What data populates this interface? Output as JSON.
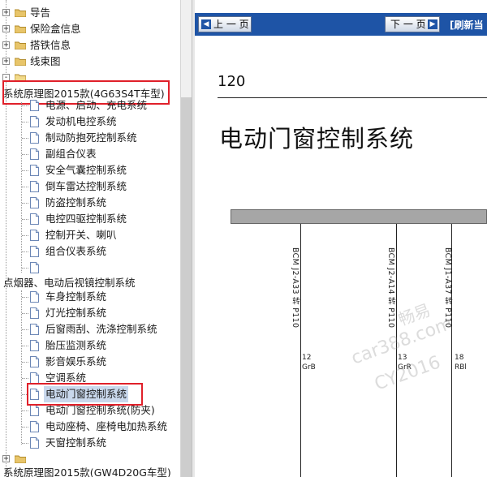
{
  "tree": {
    "top_items": [
      {
        "label": "导告"
      },
      {
        "label": "保险盒信息"
      },
      {
        "label": "搭铁信息"
      },
      {
        "label": "线束图"
      }
    ],
    "section1_title": "系统原理图2015款(4G63S4T车型)",
    "section1_items": [
      {
        "label": "电源、启动、充电系统"
      },
      {
        "label": "发动机电控系统"
      },
      {
        "label": "制动防抱死控制系统"
      },
      {
        "label": "副组合仪表"
      },
      {
        "label": "安全气囊控制系统"
      },
      {
        "label": "倒车雷达控制系统"
      },
      {
        "label": "防盗控制系统"
      },
      {
        "label": "电控四驱控制系统"
      },
      {
        "label": "控制开关、喇叭"
      },
      {
        "label": "组合仪表系统"
      },
      {
        "label": ""
      }
    ],
    "mid_text": "点烟器、电动后视镜控制系统",
    "section2_items": [
      {
        "label": "车身控制系统"
      },
      {
        "label": "灯光控制系统"
      },
      {
        "label": "后窗雨刮、洗涤控制系统"
      },
      {
        "label": "胎压监测系统"
      },
      {
        "label": "影音娱乐系统"
      },
      {
        "label": "空调系统"
      },
      {
        "label": "电动门窗控制系统",
        "selected": true
      },
      {
        "label": "电动门窗控制系统(防夹)"
      },
      {
        "label": "电动座椅、座椅电加热系统"
      },
      {
        "label": "天窗控制系统"
      }
    ],
    "section3_title": "系统原理图2015款(GW4D20G车型)"
  },
  "document": {
    "prev_button": "上 一 页",
    "next_button": "下 一 页",
    "refresh_link": "[刷新当",
    "page_number": "120",
    "title": "电动门窗控制系统",
    "columns": [
      {
        "signal": "BCM J2-A33 转 P110",
        "pin": "12",
        "wire": "GrB"
      },
      {
        "signal": "BCM J2-A14 转 P110",
        "pin": "13",
        "wire": "GrR"
      },
      {
        "signal": "BCM J1-A37 转 P110",
        "pin": "18",
        "wire": "RBl"
      }
    ],
    "watermark": [
      "畅易",
      "car388.com",
      "CY2016"
    ]
  },
  "colors": {
    "nav_bar": "#1e54a6",
    "highlight_box": "#e0202a",
    "selection": "#c9d8ec",
    "table_header": "#a6a6a6"
  }
}
